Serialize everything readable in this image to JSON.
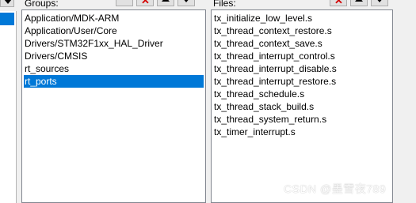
{
  "groups": {
    "label": "Groups:",
    "items": [
      {
        "label": "Application/MDK-ARM",
        "selected": false
      },
      {
        "label": "Application/User/Core",
        "selected": false
      },
      {
        "label": "Drivers/STM32F1xx_HAL_Driver",
        "selected": false
      },
      {
        "label": "Drivers/CMSIS",
        "selected": false
      },
      {
        "label": "rt_sources",
        "selected": false
      },
      {
        "label": "rt_ports",
        "selected": true
      }
    ],
    "toolbar_icons": [
      "new-icon",
      "delete-icon",
      "move-up-icon",
      "move-down-icon"
    ]
  },
  "files": {
    "label": "Files:",
    "items": [
      "tx_initialize_low_level.s",
      "tx_thread_context_restore.s",
      "tx_thread_context_save.s",
      "tx_thread_interrupt_control.s",
      "tx_thread_interrupt_disable.s",
      "tx_thread_interrupt_restore.s",
      "tx_thread_schedule.s",
      "tx_thread_stack_build.s",
      "tx_thread_system_return.s",
      "tx_timer_interrupt.s"
    ],
    "toolbar_icons": [
      "delete-icon",
      "move-up-icon",
      "move-down-icon"
    ]
  },
  "watermark": "CSDN @墨雪夜789",
  "colors": {
    "selection": "#0078d7",
    "list_border": "#828790",
    "delete_icon": "#d40000"
  }
}
